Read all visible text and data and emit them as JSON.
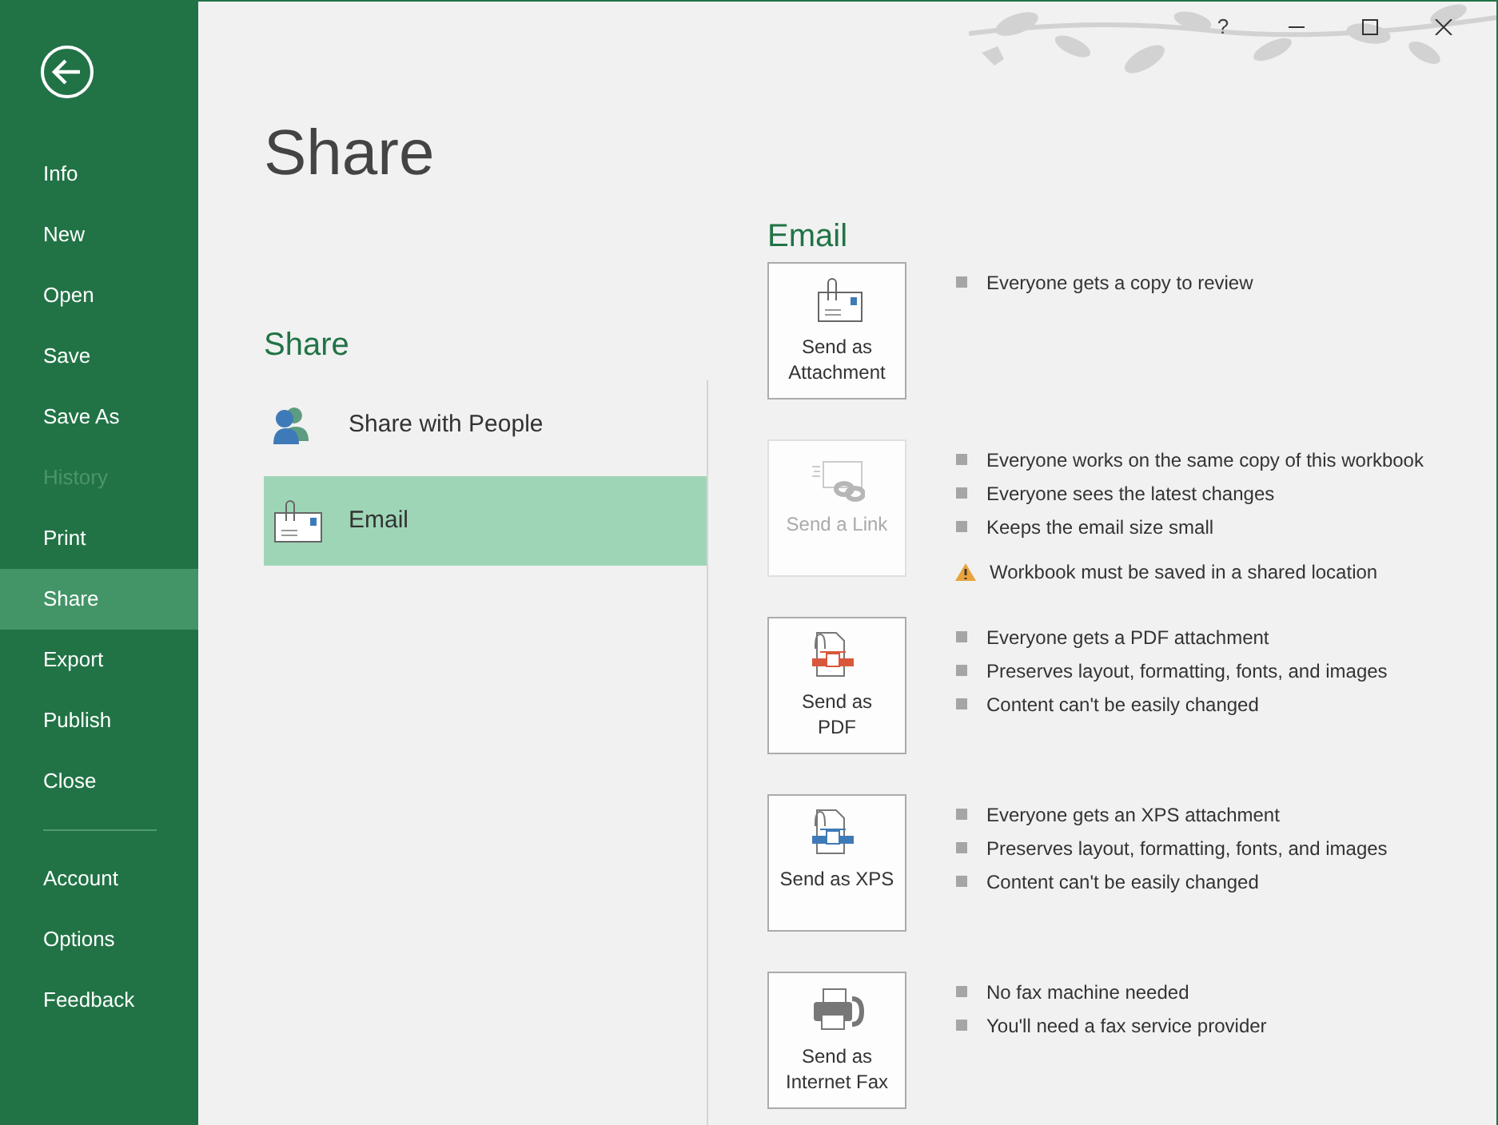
{
  "window": {
    "help": "?"
  },
  "sidebar": {
    "top_items": [
      {
        "label": "Info",
        "selected": false,
        "disabled": false
      },
      {
        "label": "New",
        "selected": false,
        "disabled": false
      },
      {
        "label": "Open",
        "selected": false,
        "disabled": false
      },
      {
        "label": "Save",
        "selected": false,
        "disabled": false
      },
      {
        "label": "Save As",
        "selected": false,
        "disabled": false
      },
      {
        "label": "History",
        "selected": false,
        "disabled": true
      },
      {
        "label": "Print",
        "selected": false,
        "disabled": false
      },
      {
        "label": "Share",
        "selected": true,
        "disabled": false
      },
      {
        "label": "Export",
        "selected": false,
        "disabled": false
      },
      {
        "label": "Publish",
        "selected": false,
        "disabled": false
      },
      {
        "label": "Close",
        "selected": false,
        "disabled": false
      }
    ],
    "bottom_items": [
      {
        "label": "Account",
        "selected": false,
        "disabled": false
      },
      {
        "label": "Options",
        "selected": false,
        "disabled": false
      },
      {
        "label": "Feedback",
        "selected": false,
        "disabled": false
      }
    ]
  },
  "page_title": "Share",
  "share": {
    "heading": "Share",
    "items": [
      {
        "label": "Share with People",
        "kind": "people",
        "selected": false
      },
      {
        "label": "Email",
        "kind": "email",
        "selected": true
      }
    ]
  },
  "email": {
    "heading": "Email",
    "options": [
      {
        "lines": [
          "Send as",
          "Attachment"
        ],
        "kind": "attachment",
        "disabled": false,
        "notes": [
          {
            "kind": "bullet",
            "text": "Everyone gets a copy to review"
          }
        ]
      },
      {
        "lines": [
          "Send a Link"
        ],
        "kind": "link",
        "disabled": true,
        "notes": [
          {
            "kind": "bullet",
            "text": "Everyone works on the same copy of this workbook"
          },
          {
            "kind": "bullet",
            "text": "Everyone sees the latest changes"
          },
          {
            "kind": "bullet",
            "text": "Keeps the email size small"
          },
          {
            "kind": "warning",
            "text": "Workbook must be saved in a shared location"
          }
        ]
      },
      {
        "lines": [
          "Send as",
          "PDF"
        ],
        "kind": "pdf",
        "disabled": false,
        "notes": [
          {
            "kind": "bullet",
            "text": "Everyone gets a PDF attachment"
          },
          {
            "kind": "bullet",
            "text": "Preserves layout, formatting, fonts, and images"
          },
          {
            "kind": "bullet",
            "text": "Content can't be easily changed"
          }
        ]
      },
      {
        "lines": [
          "Send as XPS"
        ],
        "kind": "xps",
        "disabled": false,
        "notes": [
          {
            "kind": "bullet",
            "text": "Everyone gets an XPS attachment"
          },
          {
            "kind": "bullet",
            "text": "Preserves layout, formatting, fonts, and images"
          },
          {
            "kind": "bullet",
            "text": "Content can't be easily changed"
          }
        ]
      },
      {
        "lines": [
          "Send as",
          "Internet Fax"
        ],
        "kind": "fax",
        "disabled": false,
        "notes": [
          {
            "kind": "bullet",
            "text": "No fax machine needed"
          },
          {
            "kind": "bullet",
            "text": "You'll need a fax service provider"
          }
        ]
      }
    ]
  }
}
